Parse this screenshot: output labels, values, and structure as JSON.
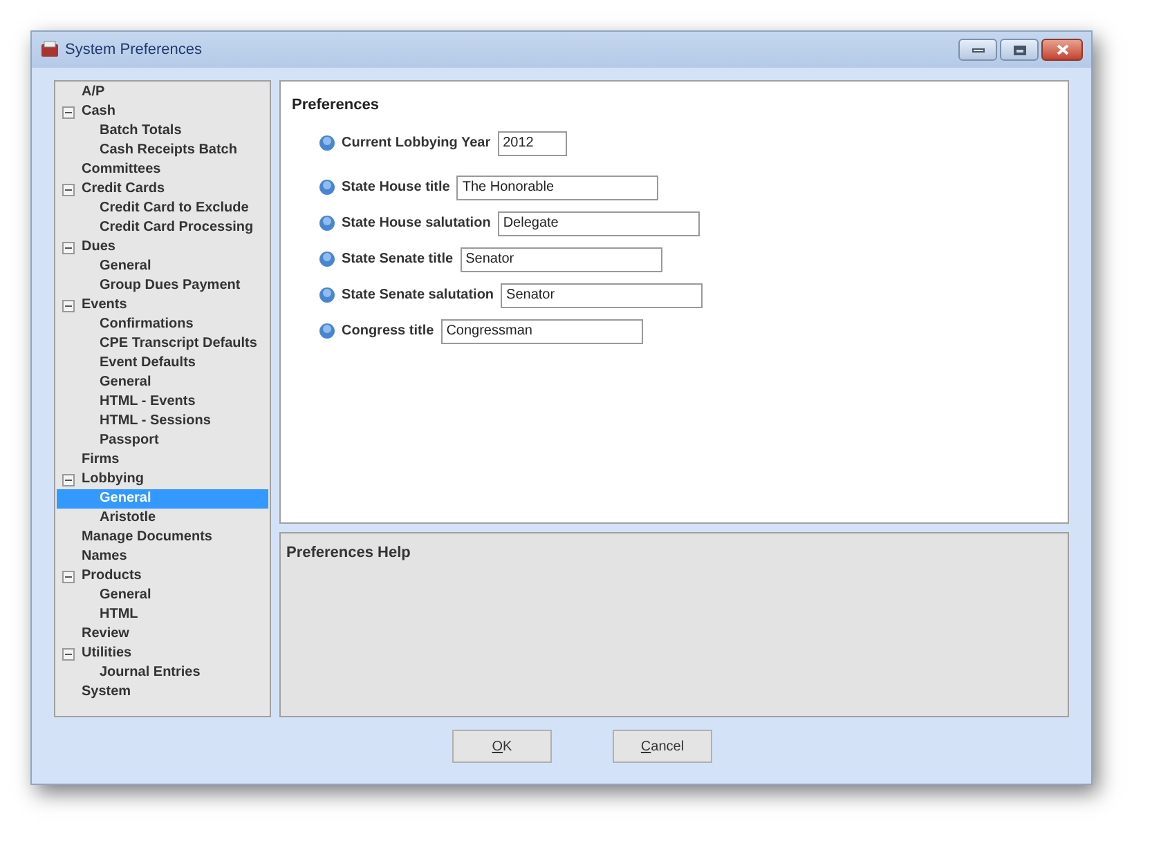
{
  "window": {
    "title": "System Preferences"
  },
  "tree": [
    {
      "label": "A/P",
      "selected": false
    },
    {
      "label": "Cash",
      "selected": false,
      "expanded": true,
      "children": [
        {
          "label": "Batch Totals",
          "selected": false
        },
        {
          "label": "Cash Receipts Batch",
          "selected": false
        }
      ]
    },
    {
      "label": "Committees",
      "selected": false
    },
    {
      "label": "Credit Cards",
      "selected": false,
      "expanded": true,
      "children": [
        {
          "label": "Credit Card to Exclude",
          "selected": false
        },
        {
          "label": "Credit Card Processing",
          "selected": false
        }
      ]
    },
    {
      "label": "Dues",
      "selected": false,
      "expanded": true,
      "children": [
        {
          "label": "General",
          "selected": false
        },
        {
          "label": "Group Dues Payment",
          "selected": false
        }
      ]
    },
    {
      "label": "Events",
      "selected": false,
      "expanded": true,
      "children": [
        {
          "label": "Confirmations",
          "selected": false
        },
        {
          "label": "CPE Transcript Defaults",
          "selected": false
        },
        {
          "label": "Event Defaults",
          "selected": false
        },
        {
          "label": "General",
          "selected": false
        },
        {
          "label": "HTML - Events",
          "selected": false
        },
        {
          "label": "HTML - Sessions",
          "selected": false
        },
        {
          "label": "Passport",
          "selected": false
        }
      ]
    },
    {
      "label": "Firms",
      "selected": false
    },
    {
      "label": "Lobbying",
      "selected": false,
      "expanded": true,
      "children": [
        {
          "label": "General",
          "selected": true
        },
        {
          "label": "Aristotle",
          "selected": false
        }
      ]
    },
    {
      "label": "Manage Documents",
      "selected": false
    },
    {
      "label": "Names",
      "selected": false
    },
    {
      "label": "Products",
      "selected": false,
      "expanded": true,
      "children": [
        {
          "label": "General",
          "selected": false
        },
        {
          "label": "HTML",
          "selected": false
        }
      ]
    },
    {
      "label": "Review",
      "selected": false
    },
    {
      "label": "Utilities",
      "selected": false,
      "expanded": true,
      "children": [
        {
          "label": "Journal Entries",
          "selected": false
        }
      ]
    },
    {
      "label": "System",
      "selected": false
    }
  ],
  "preferences": {
    "title": "Preferences",
    "fields": [
      {
        "label": "Current Lobbying Year",
        "value": "2012"
      },
      {
        "label": "State House title",
        "value": "The Honorable"
      },
      {
        "label": "State House salutation",
        "value": "Delegate"
      },
      {
        "label": "State Senate title",
        "value": "Senator"
      },
      {
        "label": "State Senate salutation",
        "value": "Senator"
      },
      {
        "label": "Congress title",
        "value": "Congressman"
      }
    ]
  },
  "help": {
    "title": "Preferences Help"
  },
  "buttons": [
    "OK",
    "Cancel"
  ]
}
